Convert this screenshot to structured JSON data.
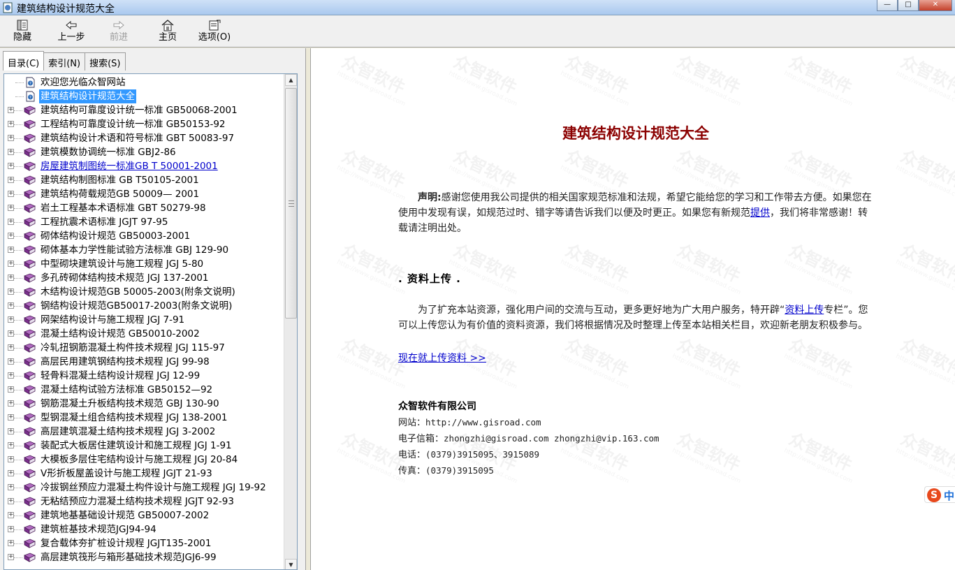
{
  "window": {
    "title": "建筑结构设计规范大全",
    "minimize": "—",
    "maximize": "□",
    "close": "✕"
  },
  "toolbar": {
    "hide": "隐藏",
    "back": "上一步",
    "forward": "前进",
    "home": "主页",
    "options": "选项(O)"
  },
  "tabs": [
    "目录(C)",
    "索引(N)",
    "搜索(S)"
  ],
  "tree": {
    "items": [
      {
        "label": "欢迎您光临众智网站",
        "type": "page",
        "expandable": false
      },
      {
        "label": "建筑结构设计规范大全",
        "type": "page",
        "expandable": false,
        "selected": true
      },
      {
        "label": "建筑结构可靠度设计统一标准 GB50068-2001",
        "type": "book",
        "expandable": true
      },
      {
        "label": "工程结构可靠度设计统一标准 GB50153-92",
        "type": "book",
        "expandable": true
      },
      {
        "label": "建筑结构设计术语和符号标准 GBT 50083-97",
        "type": "book",
        "expandable": true
      },
      {
        "label": "建筑模数协调统一标准 GBJ2-86",
        "type": "book",
        "expandable": true
      },
      {
        "label": "房屋建筑制图统一标准GB T 50001-2001",
        "type": "book",
        "expandable": true,
        "link": true
      },
      {
        "label": "建筑结构制图标准 GB T50105-2001",
        "type": "book",
        "expandable": true
      },
      {
        "label": "建筑结构荷载规范GB 50009— 2001",
        "type": "book",
        "expandable": true
      },
      {
        "label": "岩土工程基本术语标准 GBT 50279-98",
        "type": "book",
        "expandable": true
      },
      {
        "label": "工程抗震术语标准 JGJT 97-95",
        "type": "book",
        "expandable": true
      },
      {
        "label": "砌体结构设计规范 GB50003-2001",
        "type": "book",
        "expandable": true
      },
      {
        "label": "砌体基本力学性能试验方法标准 GBJ 129-90",
        "type": "book",
        "expandable": true
      },
      {
        "label": "中型砌块建筑设计与施工规程 JGJ 5-80",
        "type": "book",
        "expandable": true
      },
      {
        "label": "多孔砖砌体结构技术规范 JGJ 137-2001",
        "type": "book",
        "expandable": true
      },
      {
        "label": "木结构设计规范GB 50005-2003(附条文说明)",
        "type": "book",
        "expandable": true
      },
      {
        "label": "钢结构设计规范GB50017-2003(附条文说明)",
        "type": "book",
        "expandable": true
      },
      {
        "label": "网架结构设计与施工规程 JGJ 7-91",
        "type": "book",
        "expandable": true
      },
      {
        "label": "混凝土结构设计规范 GB50010-2002",
        "type": "book",
        "expandable": true
      },
      {
        "label": "冷轧扭钢筋混凝土构件技术规程 JGJ 115-97",
        "type": "book",
        "expandable": true
      },
      {
        "label": "高层民用建筑钢结构技术规程 JGJ 99-98",
        "type": "book",
        "expandable": true
      },
      {
        "label": "轻骨料混凝土结构设计规程 JGJ 12-99",
        "type": "book",
        "expandable": true
      },
      {
        "label": "混凝土结构试验方法标准 GB50152—92",
        "type": "book",
        "expandable": true
      },
      {
        "label": "钢筋混凝土升板结构技术规范 GBJ 130-90",
        "type": "book",
        "expandable": true
      },
      {
        "label": "型钢混凝土组合结构技术规程 JGJ 138-2001",
        "type": "book",
        "expandable": true
      },
      {
        "label": "高层建筑混凝土结构技术规程 JGJ 3-2002",
        "type": "book",
        "expandable": true
      },
      {
        "label": "装配式大板居住建筑设计和施工规程 JGJ 1-91",
        "type": "book",
        "expandable": true
      },
      {
        "label": "大模板多层住宅结构设计与施工规程 JGJ 20-84",
        "type": "book",
        "expandable": true
      },
      {
        "label": "V形折板屋盖设计与施工规程 JGJT 21-93",
        "type": "book",
        "expandable": true
      },
      {
        "label": "冷拔钢丝预应力混凝土构件设计与施工规程 JGJ 19-92",
        "type": "book",
        "expandable": true
      },
      {
        "label": "无粘结预应力混凝土结构技术规程 JGJT 92-93",
        "type": "book",
        "expandable": true
      },
      {
        "label": "建筑地基基础设计规范 GB50007-2002",
        "type": "book",
        "expandable": true
      },
      {
        "label": "建筑桩基技术规范JGJ94-94",
        "type": "book",
        "expandable": true
      },
      {
        "label": "复合载体夯扩桩设计规程 JGJT135-2001",
        "type": "book",
        "expandable": true
      },
      {
        "label": "高层建筑筏形与箱形基础技术规范JGJ6-99",
        "type": "book",
        "expandable": true
      }
    ]
  },
  "content": {
    "title": "建筑结构设计规范大全",
    "notice_label": "声明:",
    "notice_text1": "感谢您使用我公司提供的相关国家规范标准和法规，希望它能给您的学习和工作带去方便。如果您在使用中发现有误，如规范过时、错字等请告诉我们以便及时更正。如果您有新规范",
    "notice_link": "提供",
    "notice_text2": "，我们将非常感谢！转载请注明出处。",
    "section_heading": ". 资料上传 .",
    "upload_text1": "为了扩充本站资源，强化用户间的交流与互动，更多更好地为广大用户服务，特开辟“",
    "upload_link": "资料上传",
    "upload_text2": "专栏”。您可以上传您认为有价值的资料资源，我们将根据情况及时整理上传至本站相关栏目，欢迎新老朋友积极参与。",
    "upload_now": "现在就上传资料 >>",
    "company": "众智软件有限公司",
    "website_label": "网站：",
    "website": "http://www.gisroad.com",
    "email_label": "电子信箱：",
    "email": "zhongzhi@gisroad.com zhongzhi@vip.163.com",
    "phone_label": "电话：",
    "phone": "(0379)3915095、3915089",
    "fax_label": "传真：",
    "fax": "(0379)3915095"
  },
  "watermark": {
    "text": "众智软件",
    "url": "http://www.gisroad.com"
  },
  "ime": {
    "logo": "S",
    "mode": "中"
  },
  "colors": {
    "title": "#8b0000",
    "link": "#0000cc",
    "selection": "#3399ff"
  }
}
